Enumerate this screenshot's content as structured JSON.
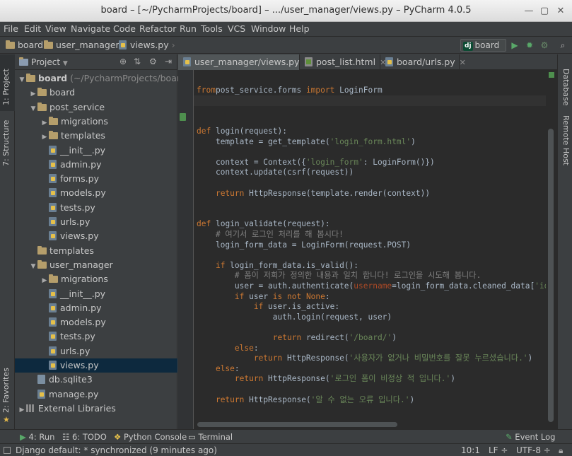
{
  "window": {
    "title": "board – [~/PycharmProjects/board] – .../user_manager/views.py – PyCharm 4.0.5"
  },
  "menu": [
    "File",
    "Edit",
    "View",
    "Navigate",
    "Code",
    "Refactor",
    "Run",
    "Tools",
    "VCS",
    "Window",
    "Help"
  ],
  "breadcrumbs": [
    "board",
    "user_manager",
    "views.py"
  ],
  "run_config": {
    "badge": "dj",
    "label": "board"
  },
  "left_tools": {
    "project": "1: Project",
    "structure": "7: Structure",
    "favorites": "2: Favorites"
  },
  "right_tools": {
    "database": "Database",
    "remote_host": "Remote Host"
  },
  "project_panel": {
    "title": "Project"
  },
  "tree": [
    {
      "label": "board",
      "suffix": " (~/PycharmProjects/board)",
      "kind": "folder",
      "depth": 0,
      "arrow": "down"
    },
    {
      "label": "board",
      "kind": "folder",
      "depth": 1,
      "arrow": "right"
    },
    {
      "label": "post_service",
      "kind": "folder",
      "depth": 1,
      "arrow": "down"
    },
    {
      "label": "migrations",
      "kind": "folder",
      "depth": 2,
      "arrow": "right"
    },
    {
      "label": "templates",
      "kind": "folder",
      "depth": 2,
      "arrow": "right"
    },
    {
      "label": "__init__.py",
      "kind": "py",
      "depth": 2
    },
    {
      "label": "admin.py",
      "kind": "py",
      "depth": 2
    },
    {
      "label": "forms.py",
      "kind": "py",
      "depth": 2
    },
    {
      "label": "models.py",
      "kind": "py",
      "depth": 2
    },
    {
      "label": "tests.py",
      "kind": "py",
      "depth": 2
    },
    {
      "label": "urls.py",
      "kind": "py",
      "depth": 2
    },
    {
      "label": "views.py",
      "kind": "py",
      "depth": 2
    },
    {
      "label": "templates",
      "kind": "folder",
      "depth": 1
    },
    {
      "label": "user_manager",
      "kind": "folder",
      "depth": 1,
      "arrow": "down"
    },
    {
      "label": "migrations",
      "kind": "folder",
      "depth": 2,
      "arrow": "right"
    },
    {
      "label": "__init__.py",
      "kind": "py",
      "depth": 2
    },
    {
      "label": "admin.py",
      "kind": "py",
      "depth": 2
    },
    {
      "label": "models.py",
      "kind": "py",
      "depth": 2
    },
    {
      "label": "tests.py",
      "kind": "py",
      "depth": 2
    },
    {
      "label": "urls.py",
      "kind": "py",
      "depth": 2
    },
    {
      "label": "views.py",
      "kind": "py",
      "depth": 2,
      "selected": true
    },
    {
      "label": "db.sqlite3",
      "kind": "db",
      "depth": 1
    },
    {
      "label": "manage.py",
      "kind": "py",
      "depth": 1
    },
    {
      "label": "External Libraries",
      "kind": "lib",
      "depth": 0,
      "arrow": "right"
    }
  ],
  "tabs": [
    {
      "label": "user_manager/views.py",
      "kind": "py",
      "active": true
    },
    {
      "label": "post_list.html",
      "kind": "html"
    },
    {
      "label": "board/urls.py",
      "kind": "py"
    }
  ],
  "code_lines": [
    [],
    [
      [
        "kw",
        "from"
      ],
      [
        "",
        "post_service.forms "
      ],
      [
        "kw",
        "import"
      ],
      [
        "",
        " LoginForm"
      ]
    ],
    [],
    [],
    [],
    [
      [
        "kw",
        "def"
      ],
      [
        "",
        " "
      ],
      [
        "fn",
        "login"
      ],
      [
        "",
        "(request):"
      ]
    ],
    [
      [
        "",
        "    template = get_template("
      ],
      [
        "st",
        "'login_form.html'"
      ],
      [
        "",
        ")"
      ]
    ],
    [],
    [
      [
        "",
        "    context = Context({"
      ],
      [
        "st",
        "'login_form'"
      ],
      [
        "",
        ": LoginForm()})"
      ]
    ],
    [
      [
        "",
        "    context.update(csrf(request))"
      ]
    ],
    [],
    [
      [
        "",
        "    "
      ],
      [
        "kw",
        "return"
      ],
      [
        "",
        " HttpResponse(template.render(context))"
      ]
    ],
    [],
    [],
    [
      [
        "kw",
        "def"
      ],
      [
        "",
        " "
      ],
      [
        "fn",
        "login_validate"
      ],
      [
        "",
        "(request):"
      ]
    ],
    [
      [
        "cm",
        "    # 여기서 로그인 처리를 해 봅시다!"
      ]
    ],
    [
      [
        "",
        "    login_form_data = LoginForm(request.POST)"
      ]
    ],
    [],
    [
      [
        "",
        "    "
      ],
      [
        "kw",
        "if"
      ],
      [
        "",
        " login_form_data.is_valid():"
      ]
    ],
    [
      [
        "cm",
        "        # 폼이 저희가 정의한 내용과 일치 합니다! 로그인을 시도해 봅니다."
      ]
    ],
    [
      [
        "",
        "        user = auth.authenticate("
      ],
      [
        "pn",
        "username"
      ],
      [
        "",
        "=login_form_data.cleaned_data["
      ],
      [
        "st",
        "'id'"
      ],
      [
        "",
        "]"
      ]
    ],
    [
      [
        "",
        "        "
      ],
      [
        "kw",
        "if"
      ],
      [
        "",
        " user "
      ],
      [
        "kw",
        "is not None"
      ],
      [
        "",
        ":"
      ]
    ],
    [
      [
        "",
        "            "
      ],
      [
        "kw",
        "if"
      ],
      [
        "",
        " user.is_active:"
      ]
    ],
    [
      [
        "",
        "                auth.login(request, user)"
      ]
    ],
    [],
    [
      [
        "",
        "                "
      ],
      [
        "kw",
        "return"
      ],
      [
        "",
        " redirect("
      ],
      [
        "st",
        "'/board/'"
      ],
      [
        "",
        ")"
      ]
    ],
    [
      [
        "",
        "        "
      ],
      [
        "kw",
        "else"
      ],
      [
        "",
        ":"
      ]
    ],
    [
      [
        "",
        "            "
      ],
      [
        "kw",
        "return"
      ],
      [
        "",
        " HttpResponse("
      ],
      [
        "st",
        "'사용자가 없거나 비밀번호를 잘못 누르셨습니다.'"
      ],
      [
        "",
        ")"
      ]
    ],
    [
      [
        "",
        "    "
      ],
      [
        "kw",
        "else"
      ],
      [
        "",
        ":"
      ]
    ],
    [
      [
        "",
        "        "
      ],
      [
        "kw",
        "return"
      ],
      [
        "",
        " HttpResponse("
      ],
      [
        "st",
        "'로그인 폼이 비정상 적 입니다.'"
      ],
      [
        "",
        ")"
      ]
    ],
    [],
    [
      [
        "",
        "    "
      ],
      [
        "kw",
        "return"
      ],
      [
        "",
        " HttpResponse("
      ],
      [
        "st",
        "'알 수 없는 오류 입니다.'"
      ],
      [
        "",
        ")"
      ]
    ]
  ],
  "tool_windows": [
    {
      "label": "4: Run",
      "icon": "run-icon"
    },
    {
      "label": "6: TODO",
      "icon": "todo-icon"
    },
    {
      "label": "Python Console",
      "icon": "python-console-icon"
    },
    {
      "label": "Terminal",
      "icon": "terminal-icon"
    },
    {
      "label": "Event Log",
      "icon": "event-log-icon"
    }
  ],
  "status": {
    "message": "Django default: * synchronized (9 minutes ago)",
    "position": "10:1",
    "line_sep": "LF ÷",
    "encoding": "UTF-8 ÷"
  },
  "colors": {
    "keyword": "#cc7832",
    "string": "#6a8759",
    "comment": "#808080",
    "param": "#aa4926",
    "selection": "#0d293e"
  }
}
